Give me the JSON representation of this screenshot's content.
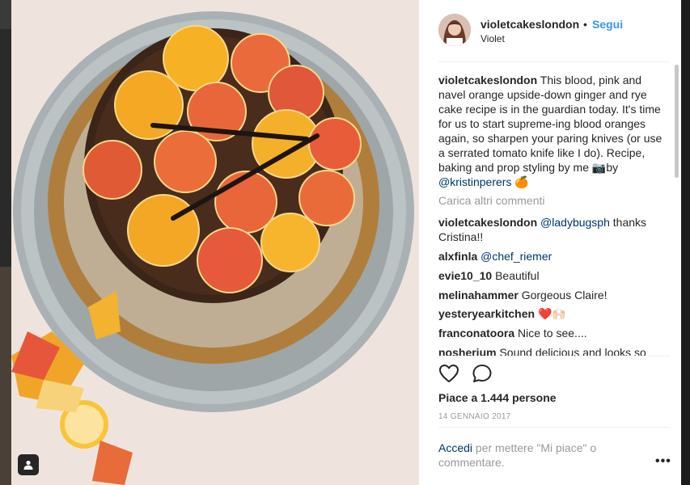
{
  "post": {
    "username": "violetcakeslondon",
    "separator": "•",
    "follow_label": "Segui",
    "display_name": "Violet"
  },
  "caption": {
    "username": "violetcakeslondon",
    "text_before": " This blood, pink and navel orange upside-down ginger and rye cake recipe is in the guardian today. It's time for us to start supreme-ing blood oranges again, so sharpen your paring knives (or use a serrated tomato knife like I do). Recipe, baking and prop styling by me ",
    "camera_emoji": "📷",
    "by_word": "by ",
    "mention": "@kristinperers",
    "emoji": "🍊"
  },
  "load_more": "Carica altri commenti",
  "comments": [
    {
      "user": "violetcakeslondon",
      "text": " ",
      "mention": "@ladybugsph",
      "text_after": " thanks Cristina!!"
    },
    {
      "user": "alxfinla",
      "text": " ",
      "mention": "@chef_riemer",
      "text_after": ""
    },
    {
      "user": "evie10_10",
      "text": " Beautiful",
      "mention": "",
      "text_after": ""
    },
    {
      "user": "melinahammer",
      "text": " Gorgeous Claire!",
      "mention": "",
      "text_after": ""
    },
    {
      "user": "yesteryearkitchen",
      "text": " ❤️🙌🏻",
      "mention": "",
      "text_after": ""
    },
    {
      "user": "franconatoora",
      "text": " Nice to see....",
      "mention": "",
      "text_after": ""
    },
    {
      "user": "nosherium",
      "text": " Sound delicious and looks so",
      "mention": "",
      "text_after": ""
    }
  ],
  "actions": {
    "heart_icon": "heart-outline",
    "comment_icon": "comment-bubble"
  },
  "likes": "Piace a 1.444 persone",
  "date": "14 GENNAIO 2017",
  "login": {
    "link": "Accedi",
    "text": " per mettere \"Mi piace\" o commentare."
  },
  "more_label": "•••",
  "colors": {
    "accent": "#3897f0",
    "link": "#003569",
    "text": "#262626",
    "muted": "#999999"
  }
}
